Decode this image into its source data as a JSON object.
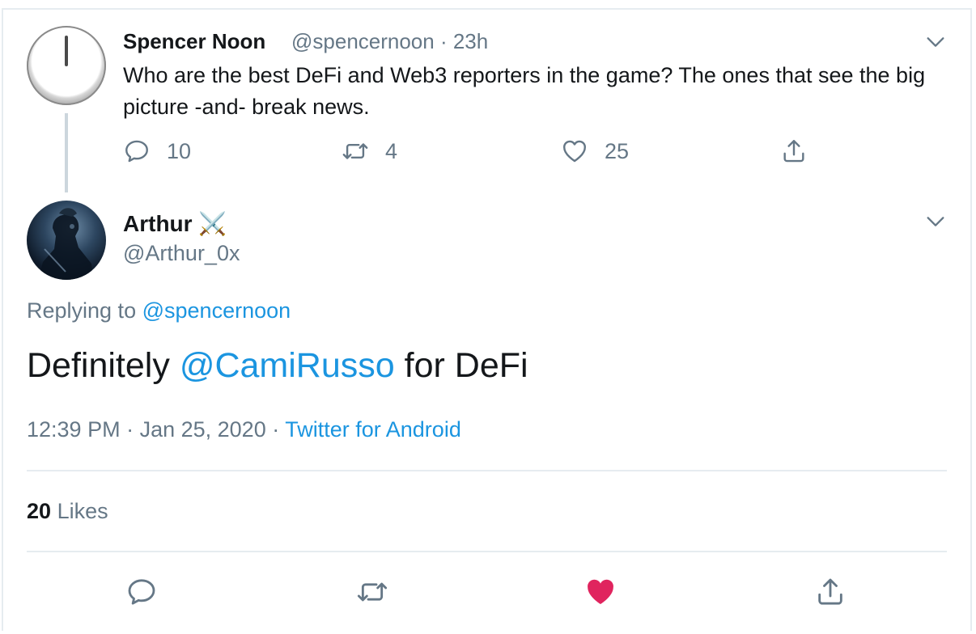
{
  "parent": {
    "name": "Spencer Noon",
    "handle": "@spencernoon",
    "time": "23h",
    "text": "Who are the best DeFi and Web3 reporters in the game? The ones that see the big picture -and- break news.",
    "replies": "10",
    "retweets": "4",
    "likes": "25",
    "avatar_icon": "clock-icon"
  },
  "reply": {
    "name": "Arthur",
    "name_emoji": "⚔️",
    "handle": "@Arthur_0x",
    "replying_prefix": "Replying to",
    "replying_to": "@spencernoon",
    "text_before": "Definitely",
    "mention": "@CamiRusso",
    "text_after": "for DeFi",
    "time": "12:39 PM",
    "date": "Jan 25, 2020",
    "source": "Twitter for Android",
    "likes_count": "20",
    "likes_label": "Likes"
  },
  "colors": {
    "link": "#1b95e0",
    "muted": "#657786",
    "text": "#14171a",
    "liked": "#e0245e",
    "divider": "#e6ecf0"
  }
}
